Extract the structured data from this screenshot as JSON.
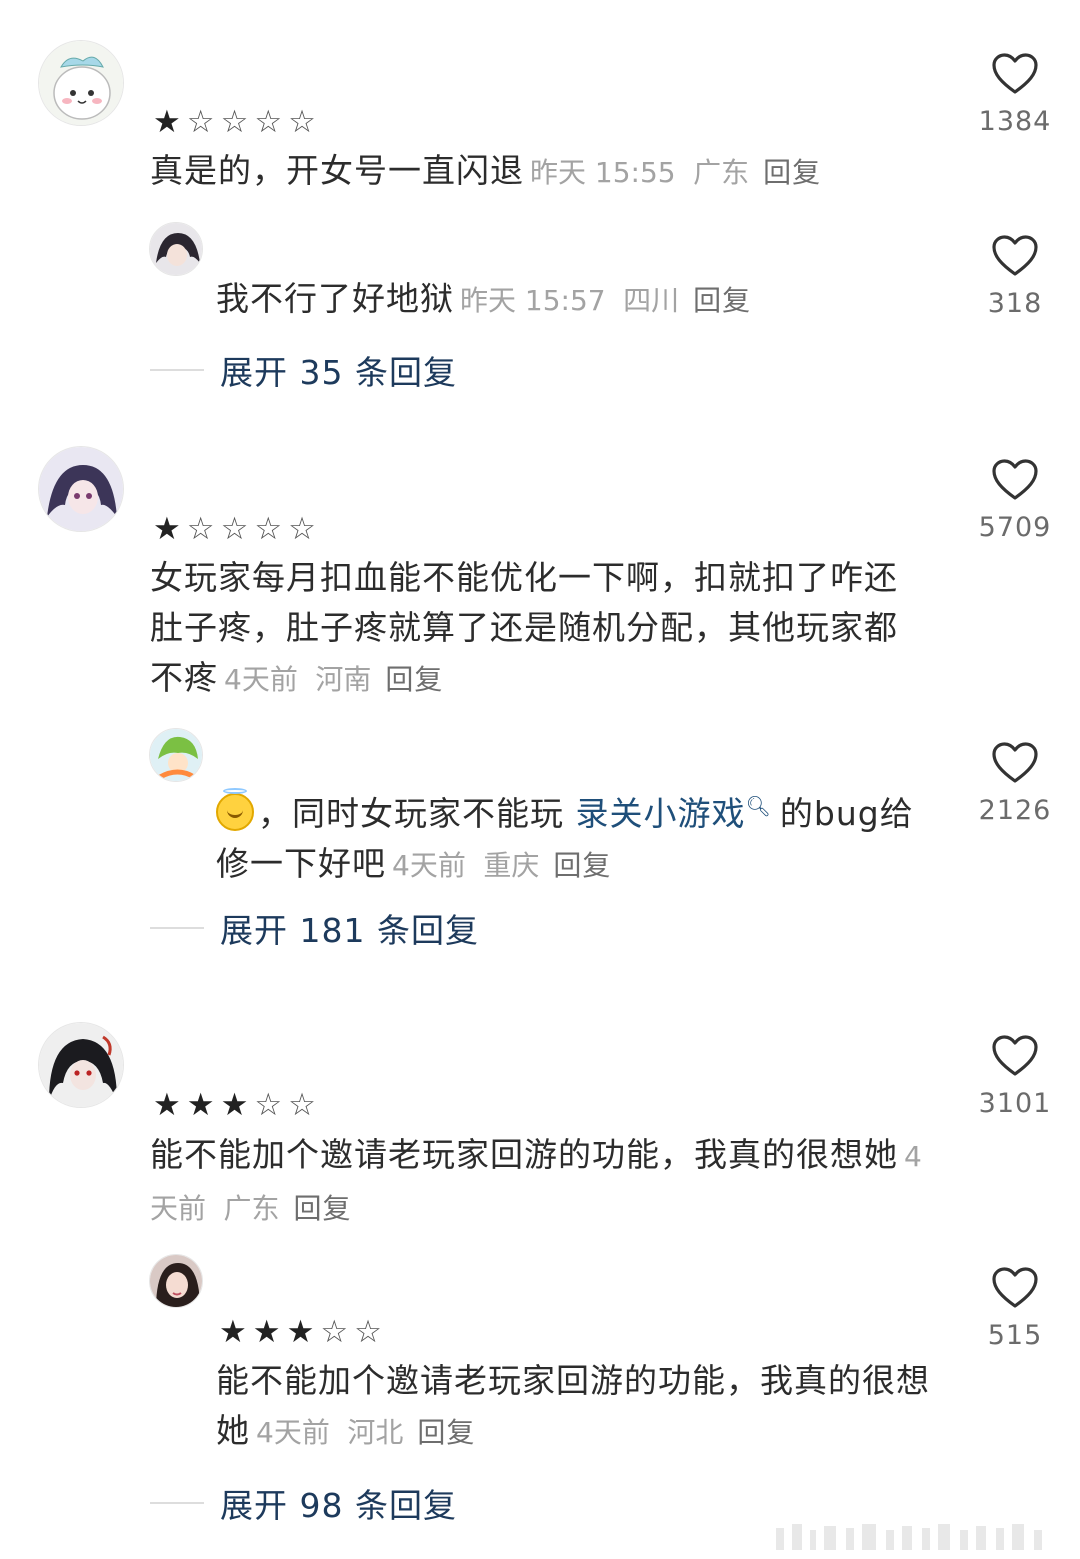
{
  "comments": [
    {
      "stars": 1,
      "text": "真是的，开女号一直闪退",
      "time": "昨天 15:55",
      "location": "广东",
      "reply_label": "回复",
      "likes": "1384",
      "avatar": "chiikawa-bunny-avatar",
      "sub": {
        "text": "我不行了好地狱",
        "time": "昨天 15:57",
        "location": "四川",
        "reply_label": "回复",
        "likes": "318",
        "avatar": "anime-dark-hair-avatar"
      },
      "expand": "展开 35 条回复"
    },
    {
      "stars": 1,
      "text": "女玩家每月扣血能不能优化一下啊，扣就扣了咋还肚子疼，肚子疼就算了还是随机分配，其他玩家都不疼",
      "time": "4天前",
      "location": "河南",
      "reply_label": "回复",
      "likes": "5709",
      "avatar": "anime-purple-girl-avatar",
      "sub": {
        "text_before": "，同时女玩家不能玩",
        "link_text": "录关小游戏",
        "text_after": "的bug给修一下好吧",
        "emoji": "smiling-face-with-halo",
        "time": "4天前",
        "location": "重庆",
        "reply_label": "回复",
        "likes": "2126",
        "avatar": "green-hair-character-avatar"
      },
      "expand": "展开 181 条回复"
    },
    {
      "stars": 3,
      "text": "能不能加个邀请老玩家回游的功能，我真的很想她",
      "time": "4天前",
      "location": "广东",
      "reply_label": "回复",
      "likes": "3101",
      "avatar": "anime-black-hair-avatar",
      "sub": {
        "stars": 3,
        "text": "能不能加个邀请老玩家回游的功能，我真的很想她",
        "time": "4天前",
        "location": "河北",
        "reply_label": "回复",
        "likes": "515",
        "avatar": "photo-girl-avatar"
      },
      "expand": "展开 98 条回复"
    }
  ],
  "colors": {
    "link": "#1f4f7a",
    "meta": "#a3a3a3",
    "expand": "#1d3a5c"
  }
}
